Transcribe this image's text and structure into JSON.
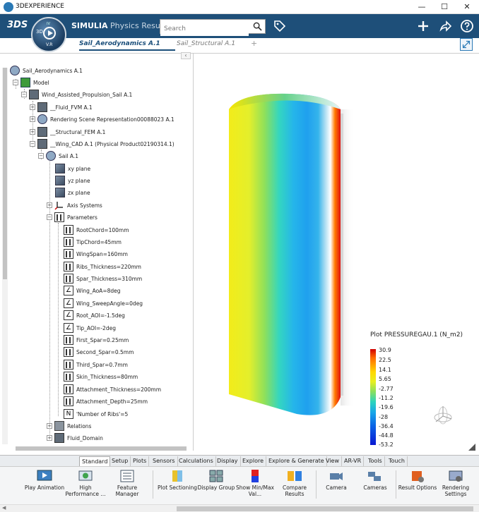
{
  "window": {
    "title": "3DEXPERIENCE",
    "minimize": "—",
    "maximize": "☐",
    "close": "✕"
  },
  "compass": {
    "label_3d": "3D",
    "label_v": "V.R",
    "label_iv": "IV"
  },
  "brand": {
    "ds_logo": "3DS"
  },
  "app": {
    "title_bold": "SIMULIA",
    "title_rest": " Physics Resul..."
  },
  "search": {
    "placeholder": "Search"
  },
  "tabs": [
    {
      "label": "Sail_Aerodynamics A.1"
    },
    {
      "label": "Sail_Structural A.1"
    },
    {
      "label": "+"
    }
  ],
  "tree": {
    "collapse_label": "‹",
    "rows": [
      {
        "label": "Sail_Aerodynamics A.1"
      },
      {
        "label": "Model"
      },
      {
        "label": "Wind_Assisted_Propulsion_Sail A.1"
      },
      {
        "label": "__Fluid_FVM A.1"
      },
      {
        "label": "Rendering Scene Representation00088023 A.1"
      },
      {
        "label": "__Structural_FEM A.1"
      },
      {
        "label": "__Wing_CAD A.1 (Physical Product02190314.1)"
      },
      {
        "label": "Sail A.1"
      },
      {
        "label": "xy plane"
      },
      {
        "label": "yz plane"
      },
      {
        "label": "zx plane"
      },
      {
        "label": "Axis Systems"
      },
      {
        "label": "Parameters"
      },
      {
        "label": "RootChord=100mm"
      },
      {
        "label": "TipChord=45mm"
      },
      {
        "label": "WingSpan=160mm"
      },
      {
        "label": "Ribs_Thickness=220mm"
      },
      {
        "label": "Spar_Thickness=310mm"
      },
      {
        "label": "Wing_AoA=8deg"
      },
      {
        "label": "Wing_SweepAngle=0deg"
      },
      {
        "label": "Root_AOI=-1.5deg"
      },
      {
        "label": "Tip_AOI=-2deg"
      },
      {
        "label": "First_Spar=0.25mm"
      },
      {
        "label": "Second_Spar=0.5mm"
      },
      {
        "label": "Third_Spar=0.7mm"
      },
      {
        "label": "Skin_Thickness=80mm"
      },
      {
        "label": "Attachment_Thickness=200mm"
      },
      {
        "label": "Attachment_Depth=25mm"
      },
      {
        "label": "'Number of Ribs'=5"
      },
      {
        "label": "Relations"
      },
      {
        "label": "Fluid_Domain"
      }
    ]
  },
  "legend": {
    "title": "Plot PRESSUREGAU.1 (N_m2)",
    "ticks": [
      "30.9",
      "22.5",
      "14.1",
      "5.65",
      "-2.77",
      "-11.2",
      "-19.6",
      "-28",
      "-36.4",
      "-44.8",
      "-53.2"
    ]
  },
  "toolbar_tabs": [
    "Standard",
    "Setup",
    "Plots",
    "Sensors",
    "Calculations",
    "Display",
    "Explore",
    "Explore & Generate",
    "View",
    "AR-VR",
    "Tools",
    "Touch"
  ],
  "actions": [
    {
      "label": "Play Animation"
    },
    {
      "label": "High Performance ..."
    },
    {
      "label": "Feature Manager"
    },
    {
      "label": "Plot Sectioning"
    },
    {
      "label": "Display Group"
    },
    {
      "label": "Show Min/Max Val..."
    },
    {
      "label": "Compare Results"
    },
    {
      "label": "Camera"
    },
    {
      "label": "Cameras"
    },
    {
      "label": "Result Options"
    },
    {
      "label": "Rendering Settings"
    }
  ],
  "colors": {
    "appbar": "#1e4f79",
    "accent": "#2a79b5"
  }
}
